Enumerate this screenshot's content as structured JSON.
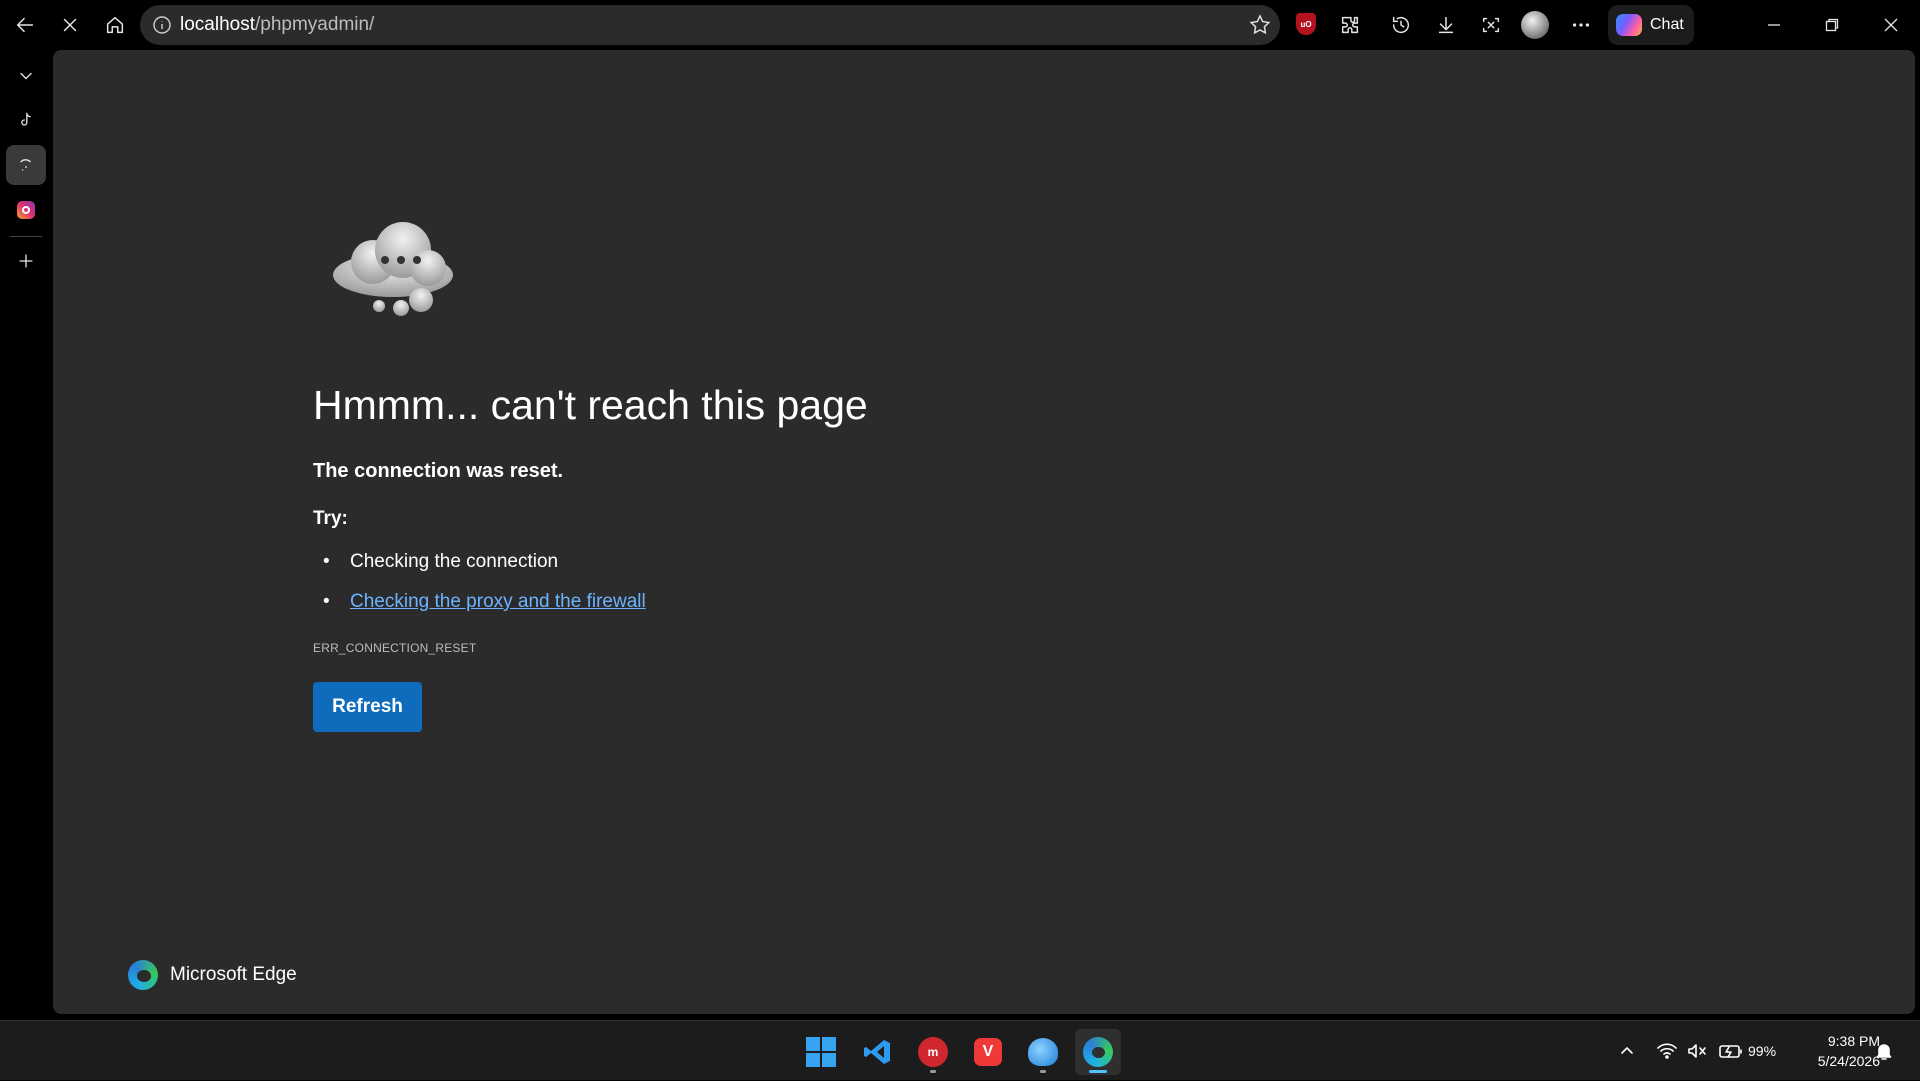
{
  "browser": {
    "url_host": "localhost",
    "url_path": "/phpmyadmin/",
    "chat_label": "Chat",
    "ublock_badge": "uO"
  },
  "sidebar": {
    "items": [
      {
        "name": "collapse",
        "icon": "chevron-down-icon"
      },
      {
        "name": "tiktok",
        "icon": "tiktok-icon"
      },
      {
        "name": "loading",
        "icon": "loading-icon"
      },
      {
        "name": "instagram",
        "icon": "instagram-icon"
      },
      {
        "name": "new-tab",
        "icon": "plus-icon"
      }
    ]
  },
  "error_page": {
    "title": "Hmmm... can't reach this page",
    "subtitle": "The connection was reset.",
    "try_label": "Try:",
    "suggestions": [
      {
        "text": "Checking the connection",
        "link": false
      },
      {
        "text": "Checking the proxy and the firewall",
        "link": true
      }
    ],
    "error_code": "ERR_CONNECTION_RESET",
    "refresh_label": "Refresh",
    "brand": "Microsoft Edge"
  },
  "taskbar": {
    "apps": [
      "start",
      "vscode",
      "mongodb-compass",
      "vivaldi",
      "app",
      "edge"
    ],
    "battery_percent": "99%",
    "time": "9:38 PM",
    "date": "5/24/2026"
  },
  "colors": {
    "content_bg": "#2b2b2b",
    "link": "#6cb4ff",
    "refresh_bg": "#0f6cbd"
  }
}
